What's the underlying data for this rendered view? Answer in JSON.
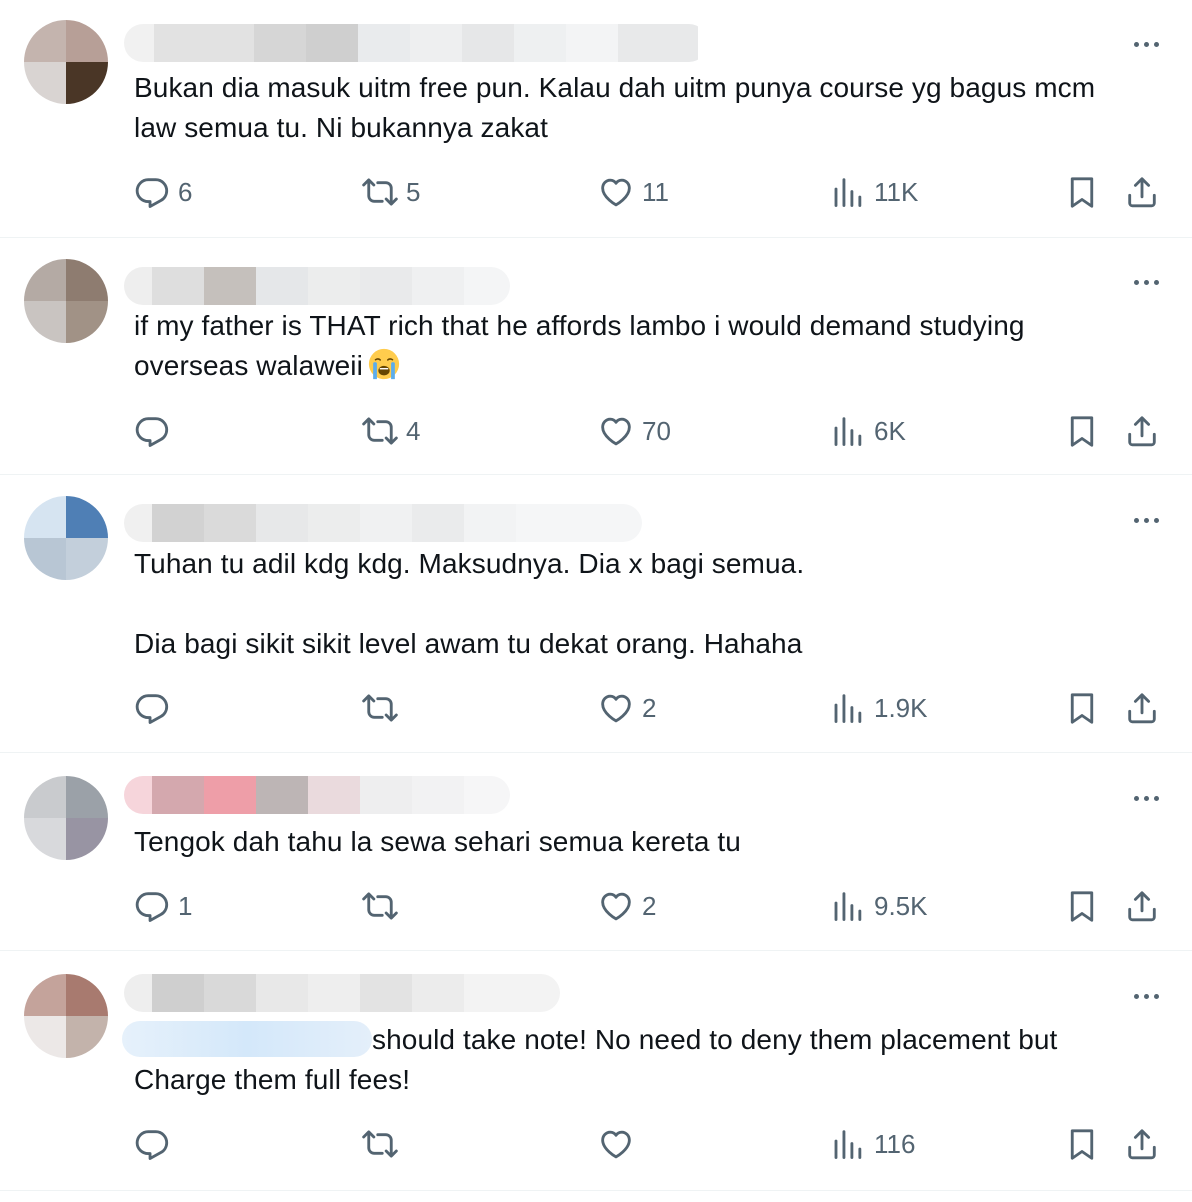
{
  "posts": [
    {
      "text": "Bukan dia masuk uitm free pun. Kalau dah uitm punya course yg bagus mcm law semua tu. Ni bukannya zakat",
      "replies": "6",
      "reposts": "5",
      "likes": "11",
      "views": "11K"
    },
    {
      "text": "if my father is THAT rich that he affords lambo i would demand studying overseas walaweii",
      "emoji": "loudly-crying-face",
      "replies": "",
      "reposts": "4",
      "likes": "70",
      "views": "6K"
    },
    {
      "text": "Tuhan tu adil kdg kdg. Maksudnya. Dia x bagi semua.\n\nDia bagi sikit sikit level awam tu dekat orang. Hahaha",
      "replies": "",
      "reposts": "",
      "likes": "2",
      "views": "1.9K"
    },
    {
      "text": "Tengok dah tahu la sewa sehari semua kereta tu",
      "replies": "1",
      "reposts": "",
      "likes": "2",
      "views": "9.5K"
    },
    {
      "text": "should take note! No need to deny them placement but Charge them full fees!",
      "replies": "",
      "reposts": "",
      "likes": "",
      "views": "116"
    }
  ],
  "colors": {
    "text": "#0f1419",
    "muted": "#536471",
    "divider": "#eff3f4"
  },
  "icons": [
    "reply-icon",
    "repost-icon",
    "like-icon",
    "views-icon",
    "bookmark-icon",
    "share-icon",
    "more-icon"
  ]
}
